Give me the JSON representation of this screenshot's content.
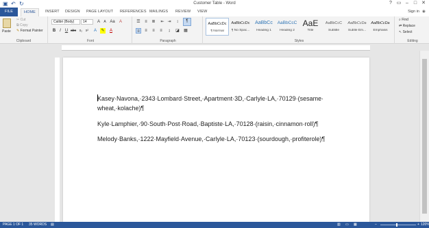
{
  "window": {
    "title": "Customer Table - Word",
    "controls": [
      "?",
      "▭",
      "–",
      "□",
      "✕"
    ]
  },
  "quick_access": {
    "save_icon": "save-icon",
    "undo_icon": "undo-icon",
    "redo_icon": "redo-icon"
  },
  "tabs": [
    "FILE",
    "HOME",
    "INSERT",
    "DESIGN",
    "PAGE LAYOUT",
    "REFERENCES",
    "MAILINGS",
    "REVIEW",
    "VIEW"
  ],
  "active_tab": "HOME",
  "account": {
    "sign_in": "Sign in"
  },
  "ribbon": {
    "clipboard": {
      "label": "Clipboard",
      "paste": "Paste",
      "cut": "Cut",
      "copy": "Copy",
      "format_painter": "Format Painter"
    },
    "font": {
      "label": "Font",
      "family": "Calibri (Body)",
      "size": "14"
    },
    "paragraph": {
      "label": "Paragraph"
    },
    "styles": {
      "label": "Styles",
      "items": [
        {
          "preview": "AaBbCcDc",
          "name": "¶ Normal"
        },
        {
          "preview": "AaBbCcDc",
          "name": "¶ No Spac..."
        },
        {
          "preview": "AaBbCc",
          "name": "Heading 1"
        },
        {
          "preview": "AaBbCcC",
          "name": "Heading 2"
        },
        {
          "preview": "AaE",
          "name": "Title"
        },
        {
          "preview": "AaBbCcC",
          "name": "Subtitle"
        },
        {
          "preview": "AaBbCcDa",
          "name": "Subtle Em..."
        },
        {
          "preview": "AaBbCcDa",
          "name": "Emphasis"
        }
      ]
    },
    "editing": {
      "label": "Editing",
      "find": "Find",
      "replace": "Replace",
      "select": "Select"
    }
  },
  "document": {
    "paragraphs": [
      "Kasey·Navona,·2343·Lombard·Street,·Apartment·3D,·Carlyle·LA,·70129·(sesame· wheat,·kolache)¶",
      "Kyle·Lamphier,·90·South·Post·Road,·Baptiste·LA,·70128·(raisin,·cinnamon·roll)¶",
      "Melody·Banks,·1222·Mayfield·Avenue,·Carlyle·LA,·70123·(sourdough,·profiterole)¶"
    ]
  },
  "status": {
    "page": "PAGE 1 OF 1",
    "words": "35 WORDS",
    "zoom_minus": "–",
    "zoom_plus": "+",
    "zoom": "120%"
  },
  "colors": {
    "accent": "#2b579a",
    "ribbon_bg": "#f3f3f3",
    "workspace": "#e6e6e6"
  }
}
